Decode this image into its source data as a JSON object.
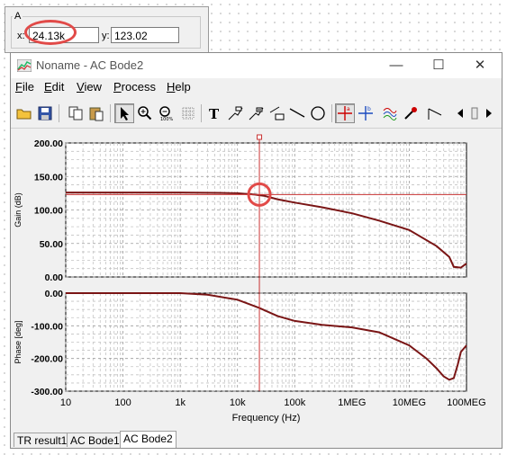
{
  "cursor": {
    "group_label": "A",
    "x_label": "x:",
    "x_value": "24.13k",
    "y_label": "y:",
    "y_value": "123.02"
  },
  "window": {
    "title": "Noname - AC Bode2",
    "minimize": "—",
    "maximize": "☐",
    "close": "✕"
  },
  "menu": [
    {
      "key": "F",
      "rest": "ile"
    },
    {
      "key": "E",
      "rest": "dit"
    },
    {
      "key": "V",
      "rest": "iew"
    },
    {
      "key": "P",
      "rest": "rocess"
    },
    {
      "key": "H",
      "rest": "elp"
    }
  ],
  "toolbar": {
    "buttons": [
      "open-icon",
      "save-icon",
      "copy-icon",
      "paste-icon",
      "pointer-icon",
      "zoom-in-icon",
      "zoom-out-icon",
      "zoom-fit-icon",
      "grid-icon",
      "text-icon",
      "marker-icon",
      "marker2-icon",
      "comment-icon",
      "line-icon",
      "ellipse-icon",
      "cursor-a-icon",
      "cursor-b-icon",
      "series-icon",
      "color-picker-icon",
      "step-icon",
      "scroll-left-icon",
      "scroll-right-icon"
    ]
  },
  "plot": {
    "x_label": "Frequency (Hz)",
    "x_ticks": [
      "10",
      "100",
      "1k",
      "10k",
      "100k",
      "1MEG",
      "10MEG",
      "100MEG"
    ],
    "gain_label": "Gain (dB)",
    "gain_ticks": [
      "200.00",
      "150.00",
      "100.00",
      "50.00",
      "0.00"
    ],
    "phase_label": "Phase [deg]",
    "phase_ticks": [
      "0.00",
      "-100.00",
      "-200.00",
      "-300.00"
    ],
    "trace_color": "#7a1515",
    "cursor_color": "#c83232",
    "ring_color": "#e14a48"
  },
  "chart_data": {
    "type": "line",
    "x_scale": "log",
    "xlim": [
      10,
      100000000
    ],
    "xlabel": "Frequency (Hz)",
    "panels": [
      {
        "name": "gain",
        "ylabel": "Gain (dB)",
        "ylim": [
          0,
          200
        ],
        "x": [
          10,
          100,
          1000,
          5000,
          10000,
          20000,
          30000,
          50000,
          100000,
          300000,
          1000000,
          3000000,
          10000000,
          30000000,
          50000000,
          60000000,
          80000000,
          100000000
        ],
        "y": [
          126,
          126,
          126,
          125.5,
          125,
          123,
          121,
          116,
          111,
          104,
          95,
          84,
          70,
          46,
          30,
          15,
          14,
          20
        ]
      },
      {
        "name": "phase",
        "ylabel": "Phase [deg]",
        "ylim": [
          -300,
          0
        ],
        "x": [
          10,
          100,
          1000,
          3000,
          10000,
          24000,
          50000,
          100000,
          300000,
          1000000,
          3000000,
          10000000,
          20000000,
          30000000,
          40000000,
          50000000,
          60000000,
          70000000,
          80000000,
          100000000
        ],
        "y": [
          0,
          0,
          0,
          -5,
          -20,
          -45,
          -70,
          -85,
          -97,
          -105,
          -120,
          -160,
          -200,
          -230,
          -255,
          -265,
          -260,
          -220,
          -180,
          -160
        ]
      }
    ],
    "cursor": {
      "x": 24130,
      "y": 123.02
    }
  },
  "tabs": [
    {
      "label": "TR result1",
      "active": false
    },
    {
      "label": "AC Bode1",
      "active": false
    },
    {
      "label": "AC Bode2",
      "active": true
    }
  ]
}
